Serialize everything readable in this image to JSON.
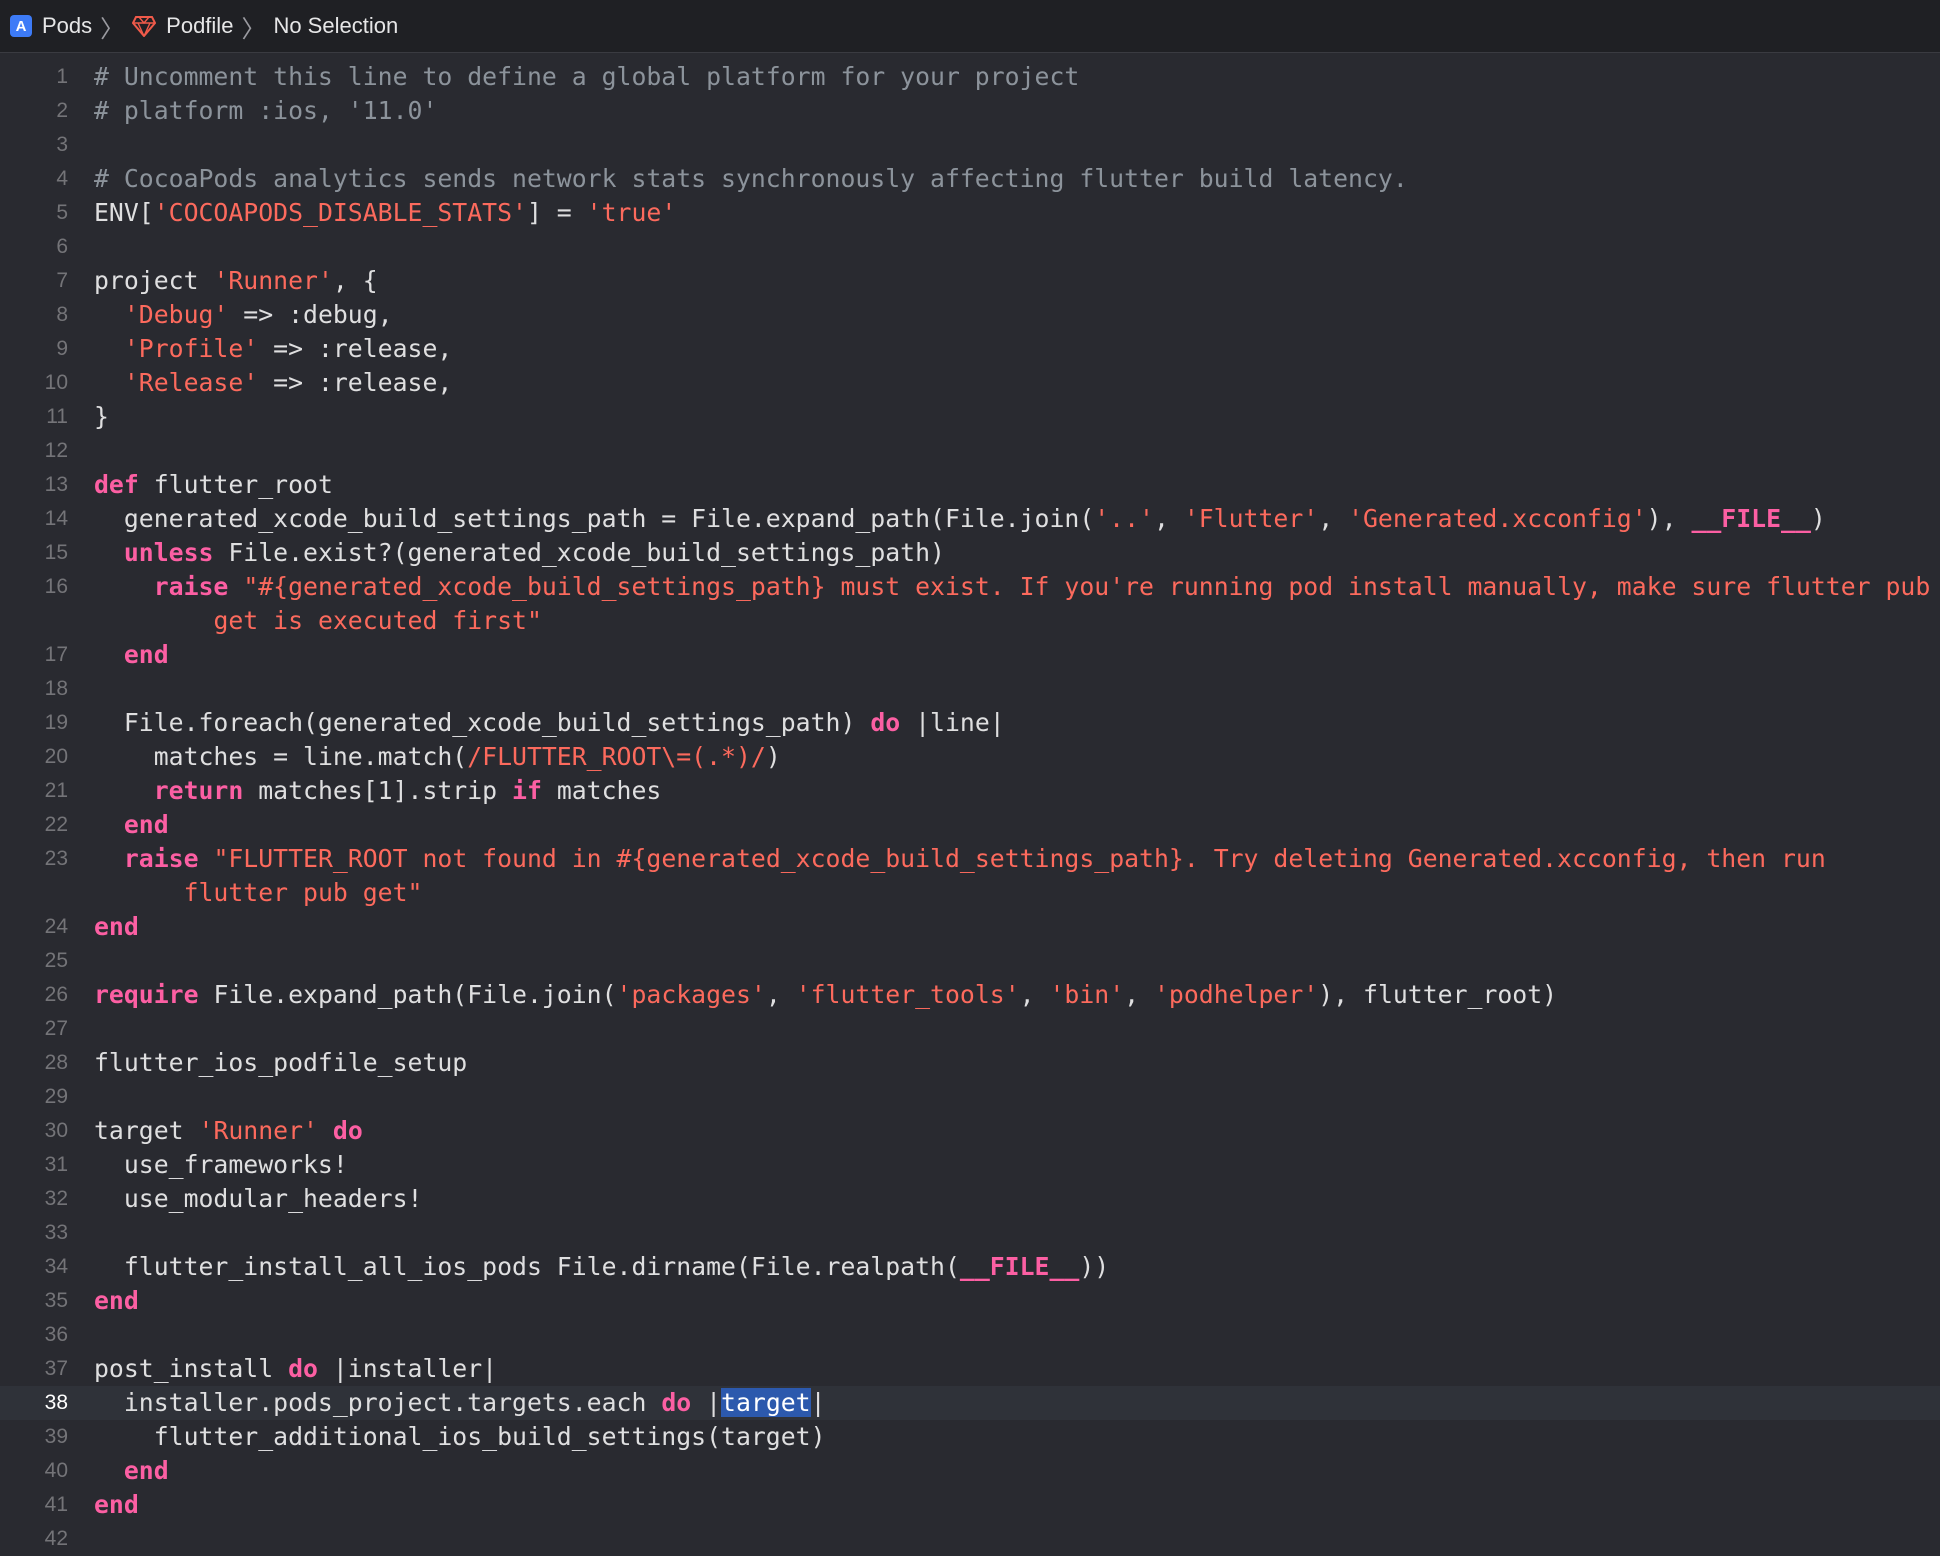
{
  "jumpbar": {
    "items": [
      {
        "label": "Pods",
        "icon": "xcode-project-icon"
      },
      {
        "label": "Podfile",
        "icon": "ruby-file-icon"
      },
      {
        "label": "No Selection",
        "icon": ""
      }
    ]
  },
  "colors": {
    "background": "#292a30",
    "comment": "#8c939b",
    "string": "#fc6a5d",
    "keyword": "#fc5fa3",
    "plain": "#dfdfe0",
    "selection": "#2c59ad"
  },
  "editor": {
    "current_line": 38,
    "lines": [
      {
        "n": "1",
        "segs": [
          [
            "c",
            "# Uncomment this line to define a global platform for your project"
          ]
        ]
      },
      {
        "n": "2",
        "segs": [
          [
            "c",
            "# platform :ios, '11.0'"
          ]
        ]
      },
      {
        "n": "3",
        "segs": []
      },
      {
        "n": "4",
        "segs": [
          [
            "c",
            "# CocoaPods analytics sends network stats synchronously affecting flutter build latency."
          ]
        ]
      },
      {
        "n": "5",
        "segs": [
          [
            "p",
            "ENV["
          ],
          [
            "s",
            "'COCOAPODS_DISABLE_STATS'"
          ],
          [
            "p",
            "] = "
          ],
          [
            "s",
            "'true'"
          ]
        ]
      },
      {
        "n": "6",
        "segs": []
      },
      {
        "n": "7",
        "segs": [
          [
            "p",
            "project "
          ],
          [
            "s",
            "'Runner'"
          ],
          [
            "p",
            ", {"
          ]
        ]
      },
      {
        "n": "8",
        "segs": [
          [
            "p",
            "  "
          ],
          [
            "s",
            "'Debug'"
          ],
          [
            "p",
            " => :debug,"
          ]
        ]
      },
      {
        "n": "9",
        "segs": [
          [
            "p",
            "  "
          ],
          [
            "s",
            "'Profile'"
          ],
          [
            "p",
            " => :release,"
          ]
        ]
      },
      {
        "n": "10",
        "segs": [
          [
            "p",
            "  "
          ],
          [
            "s",
            "'Release'"
          ],
          [
            "p",
            " => :release,"
          ]
        ]
      },
      {
        "n": "11",
        "segs": [
          [
            "p",
            "}"
          ]
        ]
      },
      {
        "n": "12",
        "segs": []
      },
      {
        "n": "13",
        "segs": [
          [
            "k",
            "def"
          ],
          [
            "p",
            " flutter_root"
          ]
        ]
      },
      {
        "n": "14",
        "segs": [
          [
            "p",
            "  generated_xcode_build_settings_path = File.expand_path(File.join("
          ],
          [
            "s",
            "'..'"
          ],
          [
            "p",
            ", "
          ],
          [
            "s",
            "'Flutter'"
          ],
          [
            "p",
            ", "
          ],
          [
            "s",
            "'Generated.xcconfig'"
          ],
          [
            "p",
            "), "
          ],
          [
            "k",
            "__FILE__"
          ],
          [
            "p",
            ")"
          ]
        ]
      },
      {
        "n": "15",
        "segs": [
          [
            "p",
            "  "
          ],
          [
            "k",
            "unless"
          ],
          [
            "p",
            " File.exist?(generated_xcode_build_settings_path)"
          ]
        ]
      },
      {
        "n": "16",
        "segs": [
          [
            "p",
            "    "
          ],
          [
            "k",
            "raise"
          ],
          [
            "p",
            " "
          ],
          [
            "s",
            "\"#{generated_xcode_build_settings_path} must exist. If you're running pod install manually, make sure flutter pub"
          ]
        ],
        "cont": [
          [
            "p",
            "        "
          ],
          [
            "s",
            "get is executed first\""
          ]
        ]
      },
      {
        "n": "17",
        "segs": [
          [
            "p",
            "  "
          ],
          [
            "k",
            "end"
          ]
        ]
      },
      {
        "n": "18",
        "segs": []
      },
      {
        "n": "19",
        "segs": [
          [
            "p",
            "  File.foreach(generated_xcode_build_settings_path) "
          ],
          [
            "k",
            "do"
          ],
          [
            "p",
            " |line|"
          ]
        ]
      },
      {
        "n": "20",
        "segs": [
          [
            "p",
            "    matches = line.match("
          ],
          [
            "s",
            "/FLUTTER_ROOT\\=(.*)/"
          ],
          [
            "p",
            ")"
          ]
        ]
      },
      {
        "n": "21",
        "segs": [
          [
            "p",
            "    "
          ],
          [
            "k",
            "return"
          ],
          [
            "p",
            " matches[1].strip "
          ],
          [
            "k",
            "if"
          ],
          [
            "p",
            " matches"
          ]
        ]
      },
      {
        "n": "22",
        "segs": [
          [
            "p",
            "  "
          ],
          [
            "k",
            "end"
          ]
        ]
      },
      {
        "n": "23",
        "segs": [
          [
            "p",
            "  "
          ],
          [
            "k",
            "raise"
          ],
          [
            "p",
            " "
          ],
          [
            "s",
            "\"FLUTTER_ROOT not found in #{generated_xcode_build_settings_path}. Try deleting Generated.xcconfig, then run"
          ]
        ],
        "cont": [
          [
            "p",
            "      "
          ],
          [
            "s",
            "flutter pub get\""
          ]
        ]
      },
      {
        "n": "24",
        "segs": [
          [
            "k",
            "end"
          ]
        ]
      },
      {
        "n": "25",
        "segs": []
      },
      {
        "n": "26",
        "segs": [
          [
            "k",
            "require"
          ],
          [
            "p",
            " File.expand_path(File.join("
          ],
          [
            "s",
            "'packages'"
          ],
          [
            "p",
            ", "
          ],
          [
            "s",
            "'flutter_tools'"
          ],
          [
            "p",
            ", "
          ],
          [
            "s",
            "'bin'"
          ],
          [
            "p",
            ", "
          ],
          [
            "s",
            "'podhelper'"
          ],
          [
            "p",
            "), flutter_root)"
          ]
        ]
      },
      {
        "n": "27",
        "segs": []
      },
      {
        "n": "28",
        "segs": [
          [
            "p",
            "flutter_ios_podfile_setup"
          ]
        ]
      },
      {
        "n": "29",
        "segs": []
      },
      {
        "n": "30",
        "segs": [
          [
            "p",
            "target "
          ],
          [
            "s",
            "'Runner'"
          ],
          [
            "p",
            " "
          ],
          [
            "k",
            "do"
          ]
        ]
      },
      {
        "n": "31",
        "segs": [
          [
            "p",
            "  use_frameworks!"
          ]
        ]
      },
      {
        "n": "32",
        "segs": [
          [
            "p",
            "  use_modular_headers!"
          ]
        ]
      },
      {
        "n": "33",
        "segs": []
      },
      {
        "n": "34",
        "segs": [
          [
            "p",
            "  flutter_install_all_ios_pods File.dirname(File.realpath("
          ],
          [
            "k",
            "__FILE__"
          ],
          [
            "p",
            "))"
          ]
        ]
      },
      {
        "n": "35",
        "segs": [
          [
            "k",
            "end"
          ]
        ]
      },
      {
        "n": "36",
        "segs": []
      },
      {
        "n": "37",
        "segs": [
          [
            "p",
            "post_install "
          ],
          [
            "k",
            "do"
          ],
          [
            "p",
            " |installer|"
          ]
        ]
      },
      {
        "n": "38",
        "segs": [
          [
            "p",
            "  installer.pods_project.targets.each "
          ],
          [
            "k",
            "do"
          ],
          [
            "p",
            " |"
          ],
          [
            "sel",
            "target"
          ],
          [
            "p",
            "|"
          ]
        ]
      },
      {
        "n": "39",
        "segs": [
          [
            "p",
            "    flutter_additional_ios_build_settings(target)"
          ]
        ]
      },
      {
        "n": "40",
        "segs": [
          [
            "p",
            "  "
          ],
          [
            "k",
            "end"
          ]
        ]
      },
      {
        "n": "41",
        "segs": [
          [
            "k",
            "end"
          ]
        ]
      },
      {
        "n": "42",
        "segs": []
      }
    ]
  }
}
